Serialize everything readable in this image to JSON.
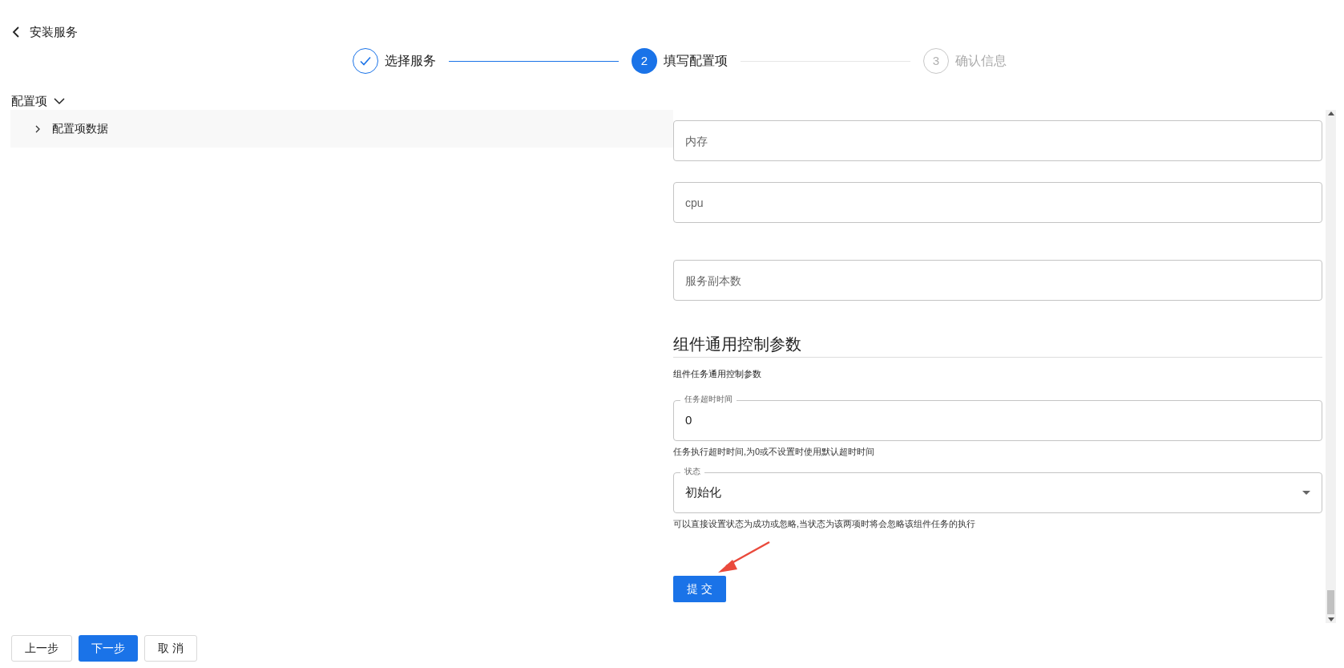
{
  "header": {
    "title": "安装服务"
  },
  "steps": [
    {
      "label": "选择服务",
      "completed": true,
      "selected": false
    },
    {
      "number": "2",
      "label": "填写配置项",
      "completed": false,
      "selected": true
    },
    {
      "number": "3",
      "label": "确认信息",
      "completed": false,
      "selected": false
    }
  ],
  "config": {
    "title": "配置项",
    "expanded": true,
    "panel": {
      "label": "配置项数据",
      "expanded": false
    }
  },
  "form": {
    "fields": [
      {
        "kind": "text",
        "placeholder": "内存"
      },
      {
        "kind": "text",
        "placeholder": "cpu"
      },
      {
        "kind": "text",
        "placeholder": "服务副本数"
      }
    ],
    "section": {
      "title": "组件通用控制参数",
      "description": "组件任务通用控制参数",
      "fields": [
        {
          "kind": "input",
          "label": "任务超时时间",
          "value": "0",
          "help": "任务执行超时时间,为0或不设置时使用默认超时时间"
        },
        {
          "kind": "select",
          "label": "状态",
          "value": "初始化",
          "help": "可以直接设置状态为成功或忽略,当状态为该两项时将会忽略该组件任务的执行"
        }
      ]
    },
    "submit": "提 交"
  },
  "footer": {
    "buttons": [
      {
        "label": "上一步",
        "primary": false
      },
      {
        "label": "下一步",
        "primary": true
      },
      {
        "label": "取 消",
        "primary": false
      }
    ]
  }
}
